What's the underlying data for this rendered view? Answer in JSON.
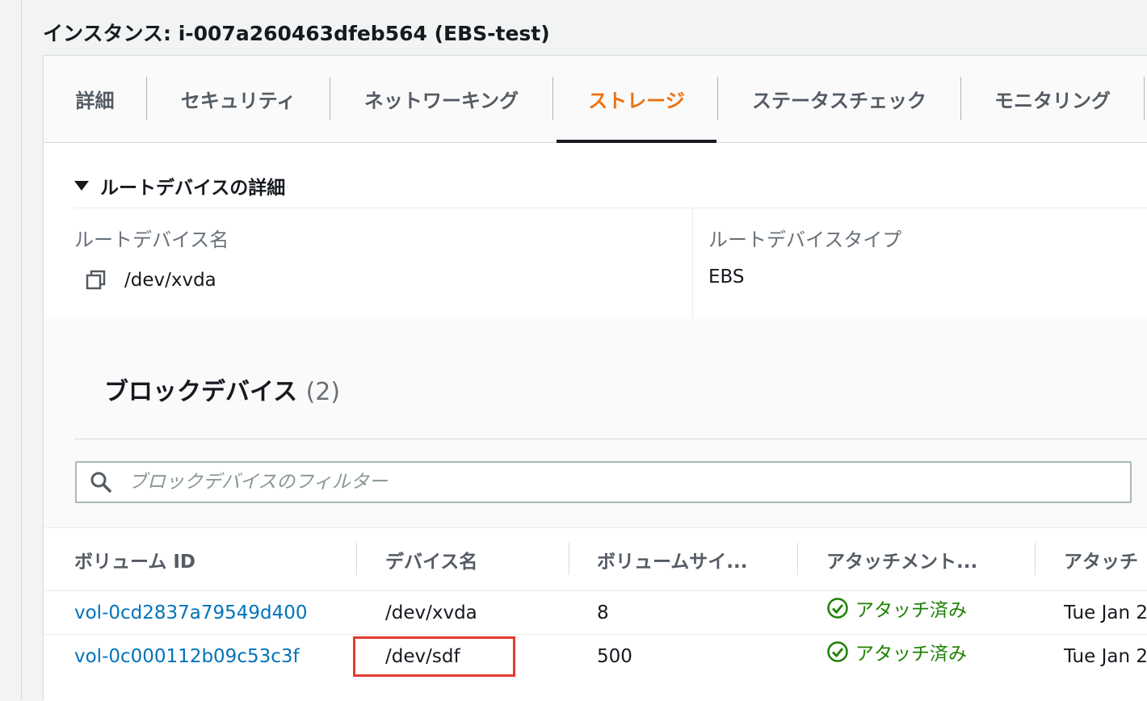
{
  "instance": {
    "title": "インスタンス: i-007a260463dfeb564 (EBS-test)"
  },
  "tabs": [
    {
      "label": "詳細"
    },
    {
      "label": "セキュリティ"
    },
    {
      "label": "ネットワーキング"
    },
    {
      "label": "ストレージ",
      "active": true
    },
    {
      "label": "ステータスチェック"
    },
    {
      "label": "モニタリング"
    }
  ],
  "root_device": {
    "section_title": "ルートデバイスの詳細",
    "name_label": "ルートデバイス名",
    "name_value": "/dev/xvda",
    "type_label": "ルートデバイスタイプ",
    "type_value": "EBS"
  },
  "block_devices": {
    "title": "ブロックデバイス",
    "count": "(2)",
    "filter_placeholder": "ブロックデバイスのフィルター",
    "columns": [
      "ボリューム ID",
      "デバイス名",
      "ボリュームサイ...",
      "アタッチメント...",
      "アタッチ"
    ],
    "rows": [
      {
        "volume_id": "vol-0cd2837a79549d400",
        "device": "/dev/xvda",
        "size": "8",
        "status": "アタッチ済み",
        "time": "Tue Jan 2"
      },
      {
        "volume_id": "vol-0c000112b09c53c3f",
        "device": "/dev/sdf",
        "size": "500",
        "status": "アタッチ済み",
        "time": "Tue Jan 2"
      }
    ]
  },
  "colors": {
    "accent": "#ec7211",
    "link": "#0073bb",
    "success": "#1d8102",
    "highlight": "#e53b2c"
  }
}
